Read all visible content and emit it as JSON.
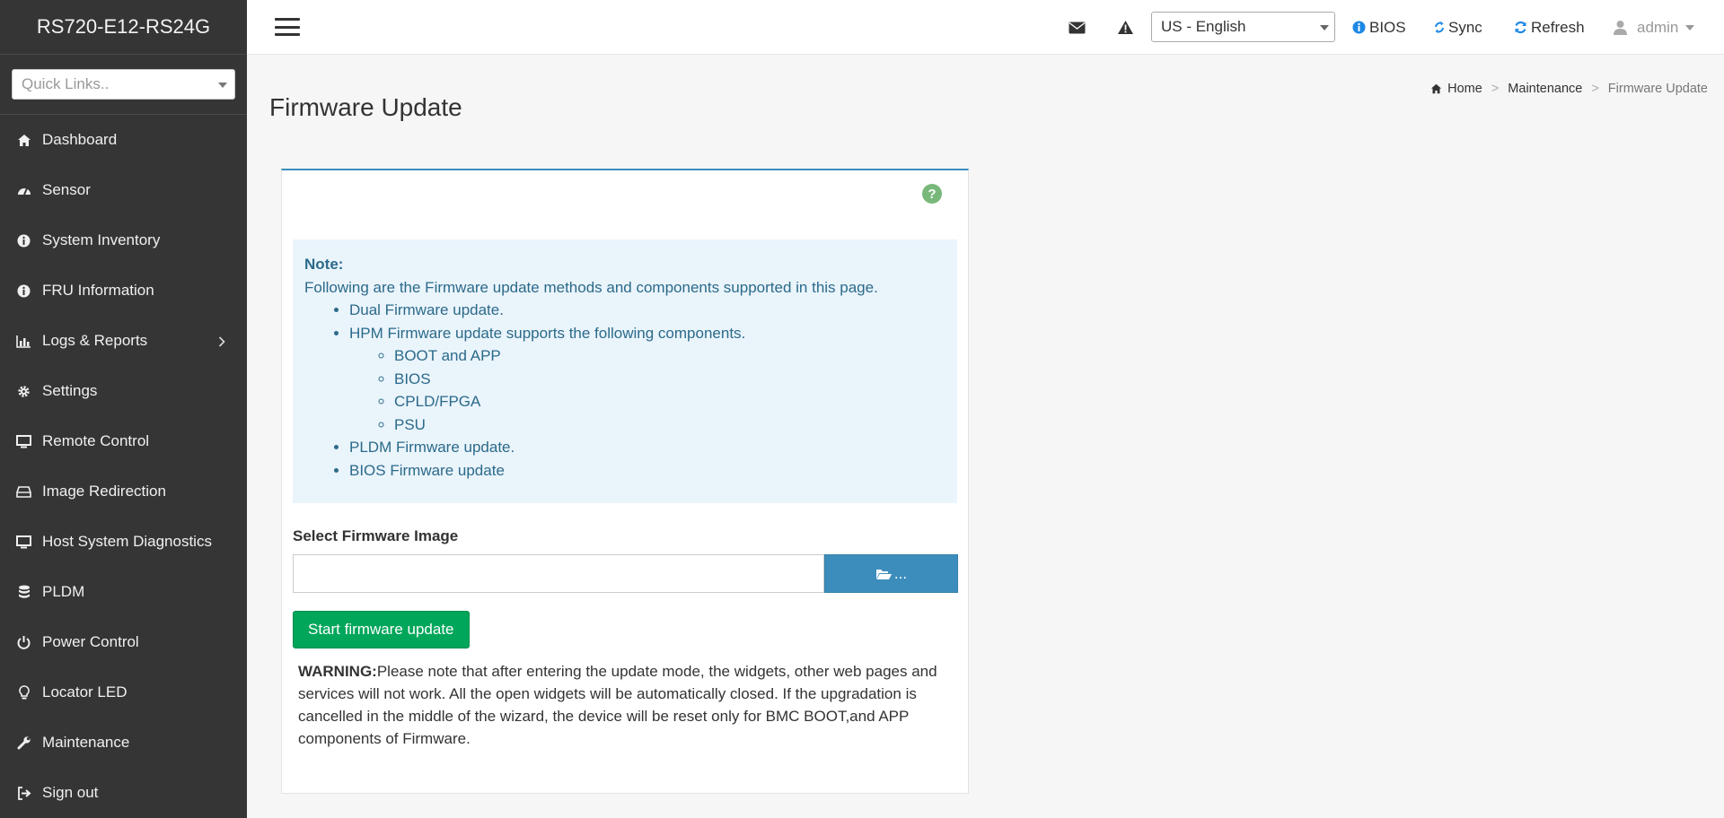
{
  "brand": "RS720-E12-RS24G",
  "quick_links": {
    "placeholder": "Quick Links.."
  },
  "sidebar": {
    "items": [
      {
        "label": "Dashboard",
        "icon": "home-icon"
      },
      {
        "label": "Sensor",
        "icon": "gauge-icon"
      },
      {
        "label": "System Inventory",
        "icon": "info-icon"
      },
      {
        "label": "FRU Information",
        "icon": "info-icon"
      },
      {
        "label": "Logs & Reports",
        "icon": "bar-chart-icon"
      },
      {
        "label": "Settings",
        "icon": "gear-icon"
      },
      {
        "label": "Remote Control",
        "icon": "monitor-icon"
      },
      {
        "label": "Image Redirection",
        "icon": "drive-icon"
      },
      {
        "label": "Host System Diagnostics",
        "icon": "monitor-icon"
      },
      {
        "label": "PLDM",
        "icon": "database-icon"
      },
      {
        "label": "Power Control",
        "icon": "power-icon"
      },
      {
        "label": "Locator LED",
        "icon": "lightbulb-icon"
      },
      {
        "label": "Maintenance",
        "icon": "wrench-icon"
      },
      {
        "label": "Sign out",
        "icon": "sign-out-icon"
      }
    ]
  },
  "topbar": {
    "language": "US - English",
    "bios": "BIOS",
    "sync": "Sync",
    "refresh": "Refresh",
    "user": "admin"
  },
  "page": {
    "title": "Firmware Update",
    "breadcrumb": {
      "home": "Home",
      "section": "Maintenance",
      "current": "Firmware Update"
    }
  },
  "note": {
    "title": "Note:",
    "intro": "Following are the Firmware update methods and components supported in this page.",
    "items": [
      "Dual Firmware update.",
      "HPM Firmware update supports the following components.",
      "PLDM Firmware update.",
      "BIOS Firmware update"
    ],
    "hpm_components": [
      "BOOT and APP",
      "BIOS",
      "CPLD/FPGA",
      "PSU"
    ]
  },
  "form": {
    "label": "Select Firmware Image",
    "file_value": "",
    "browse_label": "...",
    "start_label": "Start firmware update"
  },
  "warning": {
    "label": "WARNING:",
    "text": "Please note that after entering the update mode, the widgets, other web pages and services will not work. All the open widgets will be automatically closed. If the upgradation is cancelled in the middle of the wizard, the device will be reset only for BMC BOOT,and APP components of Firmware."
  },
  "colors": {
    "sidebar_bg": "#353535",
    "accent": "#3c8dbc",
    "success": "#00a65a",
    "note_bg": "#eaf4fb",
    "note_text": "#2b6a8a",
    "sync_blue": "#1e88e5"
  }
}
